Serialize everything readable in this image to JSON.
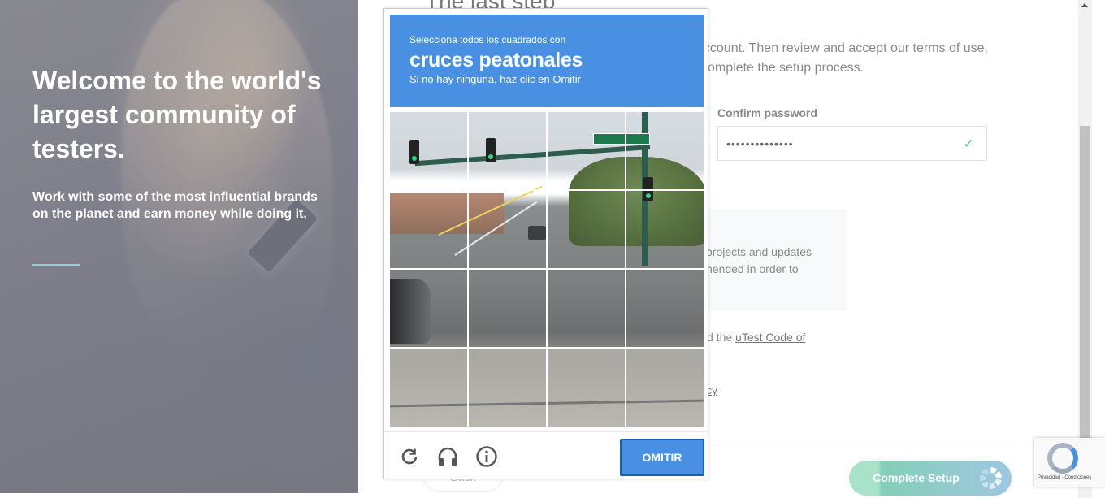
{
  "hero": {
    "title": "Welcome to the world's largest community of testers.",
    "subtitle": "Work with some of the most influential brands on the planet and earn money while doing it."
  },
  "form": {
    "step_title": "The last step",
    "intro_line1": "ccount. Then review and accept our terms of use,",
    "intro_line2": "omplete the setup process.",
    "confirm_password_label": "Confirm password",
    "confirm_password_value": "••••••••••••••",
    "info_line1": "projects and updates",
    "info_line2": "nended in order to",
    "coc_prefix": "d the ",
    "coc_link": "uTest Code of",
    "policy_link": "icy",
    "back_label": "Back",
    "complete_label": "Complete Setup"
  },
  "captcha": {
    "instruction": "Selecciona todos los cuadrados con",
    "target": "cruces peatonales",
    "hint": "Si no hay ninguna, haz clic en Omitir",
    "skip_label": "OMITIR",
    "reload_icon": "reload-icon",
    "audio_icon": "headphones-icon",
    "info_icon": "info-icon",
    "grid_rows": 4,
    "grid_cols": 4
  },
  "recaptcha_badge": {
    "terms": "Privacidad - Condiciones"
  },
  "colors": {
    "captcha_blue": "#4a90e2",
    "accent_teal": "#8ed1d9",
    "success_green": "#62c3a3"
  }
}
